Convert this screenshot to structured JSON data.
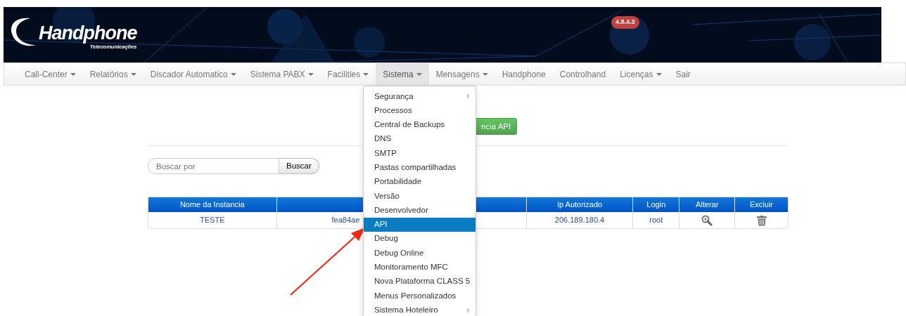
{
  "header": {
    "logo": {
      "name": "Handphone",
      "tagline": "Telecomunicações"
    },
    "version_badge": "4.8.4.3"
  },
  "nav": [
    {
      "label": "Call-Center",
      "dropdown": true,
      "selected": false
    },
    {
      "label": "Relatórios",
      "dropdown": true,
      "selected": false
    },
    {
      "label": "Discador Automatico",
      "dropdown": true,
      "selected": false
    },
    {
      "label": "Sistema PABX",
      "dropdown": true,
      "selected": false
    },
    {
      "label": "Facilities",
      "dropdown": true,
      "selected": false
    },
    {
      "label": "Sistema",
      "dropdown": true,
      "selected": true
    },
    {
      "label": "Mensagens",
      "dropdown": true,
      "selected": false
    },
    {
      "label": "Handphone",
      "dropdown": false,
      "selected": false
    },
    {
      "label": "Controlhand",
      "dropdown": false,
      "selected": false
    },
    {
      "label": "Licenças",
      "dropdown": true,
      "selected": false
    },
    {
      "label": "Sair",
      "dropdown": false,
      "selected": false
    }
  ],
  "dropdown_menu": [
    {
      "label": "Segurança",
      "submenu": true,
      "selected": false
    },
    {
      "label": "Processos",
      "submenu": false,
      "selected": false
    },
    {
      "label": "Central de Backups",
      "submenu": false,
      "selected": false
    },
    {
      "label": "DNS",
      "submenu": false,
      "selected": false
    },
    {
      "label": "SMTP",
      "submenu": false,
      "selected": false
    },
    {
      "label": "Pastas compartilhadas",
      "submenu": false,
      "selected": false
    },
    {
      "label": "Portabilidade",
      "submenu": false,
      "selected": false
    },
    {
      "label": "Versão",
      "submenu": false,
      "selected": false
    },
    {
      "label": "Desenvolvedor",
      "submenu": false,
      "selected": false
    },
    {
      "label": "API",
      "submenu": false,
      "selected": true
    },
    {
      "label": "Debug",
      "submenu": false,
      "selected": false
    },
    {
      "label": "Debug Online",
      "submenu": false,
      "selected": false
    },
    {
      "label": "Monitoramento MFC",
      "submenu": false,
      "selected": false
    },
    {
      "label": "Nova Plataforma CLASS 5",
      "submenu": false,
      "selected": false
    },
    {
      "label": "Menus Personalizados",
      "submenu": false,
      "selected": false
    },
    {
      "label": "Sistema Hoteleiro",
      "submenu": true,
      "selected": false
    }
  ],
  "new_button": "ncia API",
  "search": {
    "placeholder": "Buscar por",
    "button": "Buscar"
  },
  "table": {
    "columns": [
      "Nome da Instancia",
      "",
      "Ip Autorizado",
      "Login",
      "Alterar",
      "Excluir"
    ],
    "rows": [
      {
        "name": "TESTE",
        "column_2": "fea84ae",
        "ip": "206.189.180.4",
        "login": "root"
      }
    ]
  }
}
